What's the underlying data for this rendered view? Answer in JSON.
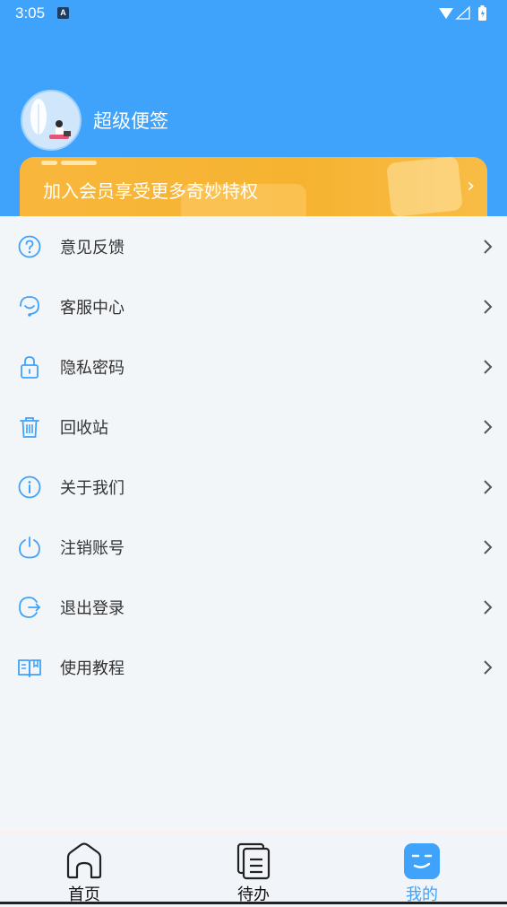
{
  "status_bar": {
    "time": "3:05",
    "notification_badge": "A"
  },
  "profile": {
    "app_name": "超级便签"
  },
  "vip_banner": {
    "text": "加入会员享受更多奇妙特权",
    "arrow": "›"
  },
  "menu": [
    {
      "label": "意见反馈",
      "icon": "question-icon"
    },
    {
      "label": "客服中心",
      "icon": "headset-icon"
    },
    {
      "label": "隐私密码",
      "icon": "lock-icon"
    },
    {
      "label": "回收站",
      "icon": "trash-icon"
    },
    {
      "label": "关于我们",
      "icon": "info-icon"
    },
    {
      "label": "注销账号",
      "icon": "power-icon"
    },
    {
      "label": "退出登录",
      "icon": "logout-icon"
    },
    {
      "label": "使用教程",
      "icon": "book-icon"
    }
  ],
  "tabs": [
    {
      "label": "首页",
      "icon": "home-icon",
      "active": false
    },
    {
      "label": "待办",
      "icon": "todo-icon",
      "active": false
    },
    {
      "label": "我的",
      "icon": "profile-face-icon",
      "active": true
    }
  ],
  "colors": {
    "accent": "#3fa2fb",
    "vip": "#f6b331",
    "menu_icon": "#3fa2fb"
  }
}
